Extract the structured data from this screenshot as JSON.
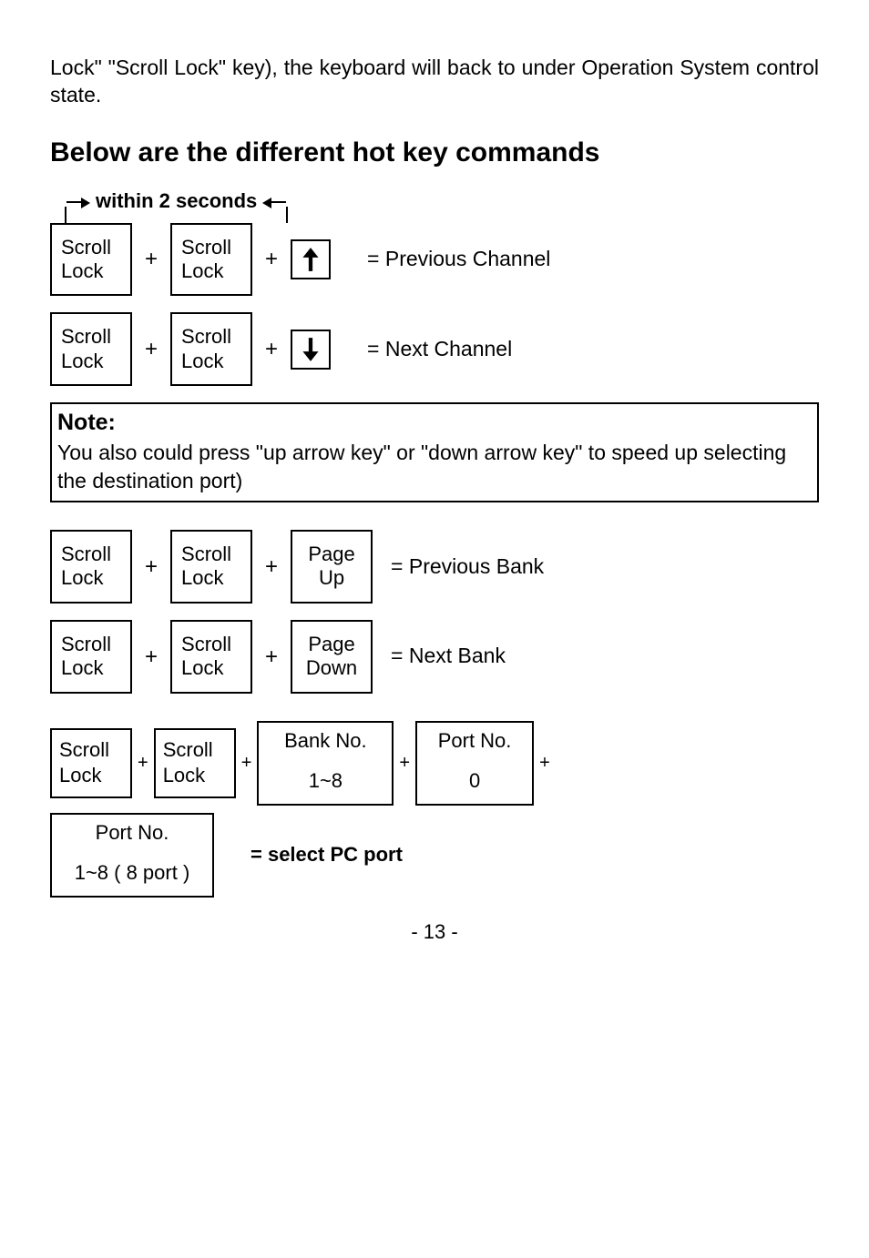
{
  "intro": "Lock\" \"Scroll Lock\" key), the keyboard will back to under Operation System control state.",
  "heading": "Below are the different hot key commands",
  "within": "within 2 seconds",
  "keys": {
    "scroll": "Scroll\nLock",
    "pageUp": "Page\nUp",
    "pageDown": "Page\nDown",
    "bankNo": "Bank No.",
    "bankRange": "1~8",
    "portNo": "Port No.",
    "portZero": "0",
    "portRange": "1~8 ( 8 port )"
  },
  "results": {
    "prevCh": "= Previous Channel",
    "nextCh": "= Next Channel",
    "prevBank": "= Previous Bank",
    "nextBank": "= Next Bank",
    "selectPort": "= select PC port"
  },
  "note": {
    "title": "Note:",
    "body": "You also could press \"up arrow key\" or \"down arrow key\" to speed up selecting the destination port)"
  },
  "plus": "+",
  "pageNum": "- 13 -"
}
